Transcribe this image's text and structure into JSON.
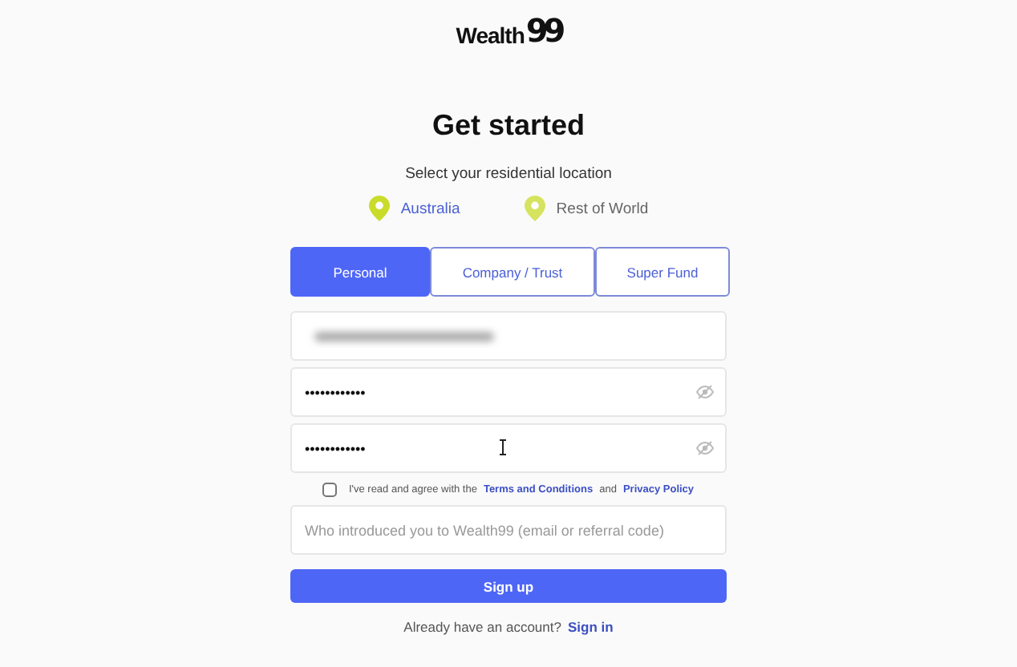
{
  "logo": {
    "word": "Wealth",
    "mark": "99"
  },
  "title": "Get started",
  "location": {
    "label": "Select your residential location",
    "options": [
      {
        "label": "Australia",
        "selected": true
      },
      {
        "label": "Rest of World",
        "selected": false
      }
    ]
  },
  "account_types": [
    {
      "label": "Personal",
      "selected": true
    },
    {
      "label": "Company / Trust",
      "selected": false
    },
    {
      "label": "Super Fund",
      "selected": false
    }
  ],
  "fields": [
    {
      "kind": "blurred"
    },
    {
      "kind": "password",
      "value": "••••••••••••",
      "cursor": false
    },
    {
      "kind": "password",
      "value": "••••••••••••",
      "cursor": true
    }
  ],
  "agreement": {
    "checked": false,
    "parts": [
      {
        "kind": "text",
        "text": "I've read and agree with the"
      },
      {
        "kind": "link",
        "text": "Terms and Conditions"
      },
      {
        "kind": "text",
        "text": "and"
      },
      {
        "kind": "link",
        "text": "Privacy Policy"
      }
    ]
  },
  "referral": {
    "placeholder": "Who introduced you to Wealth99 (email or referral code)"
  },
  "submit": "Sign up",
  "footer": {
    "text": "Already have an account?",
    "link": "Sign in"
  }
}
